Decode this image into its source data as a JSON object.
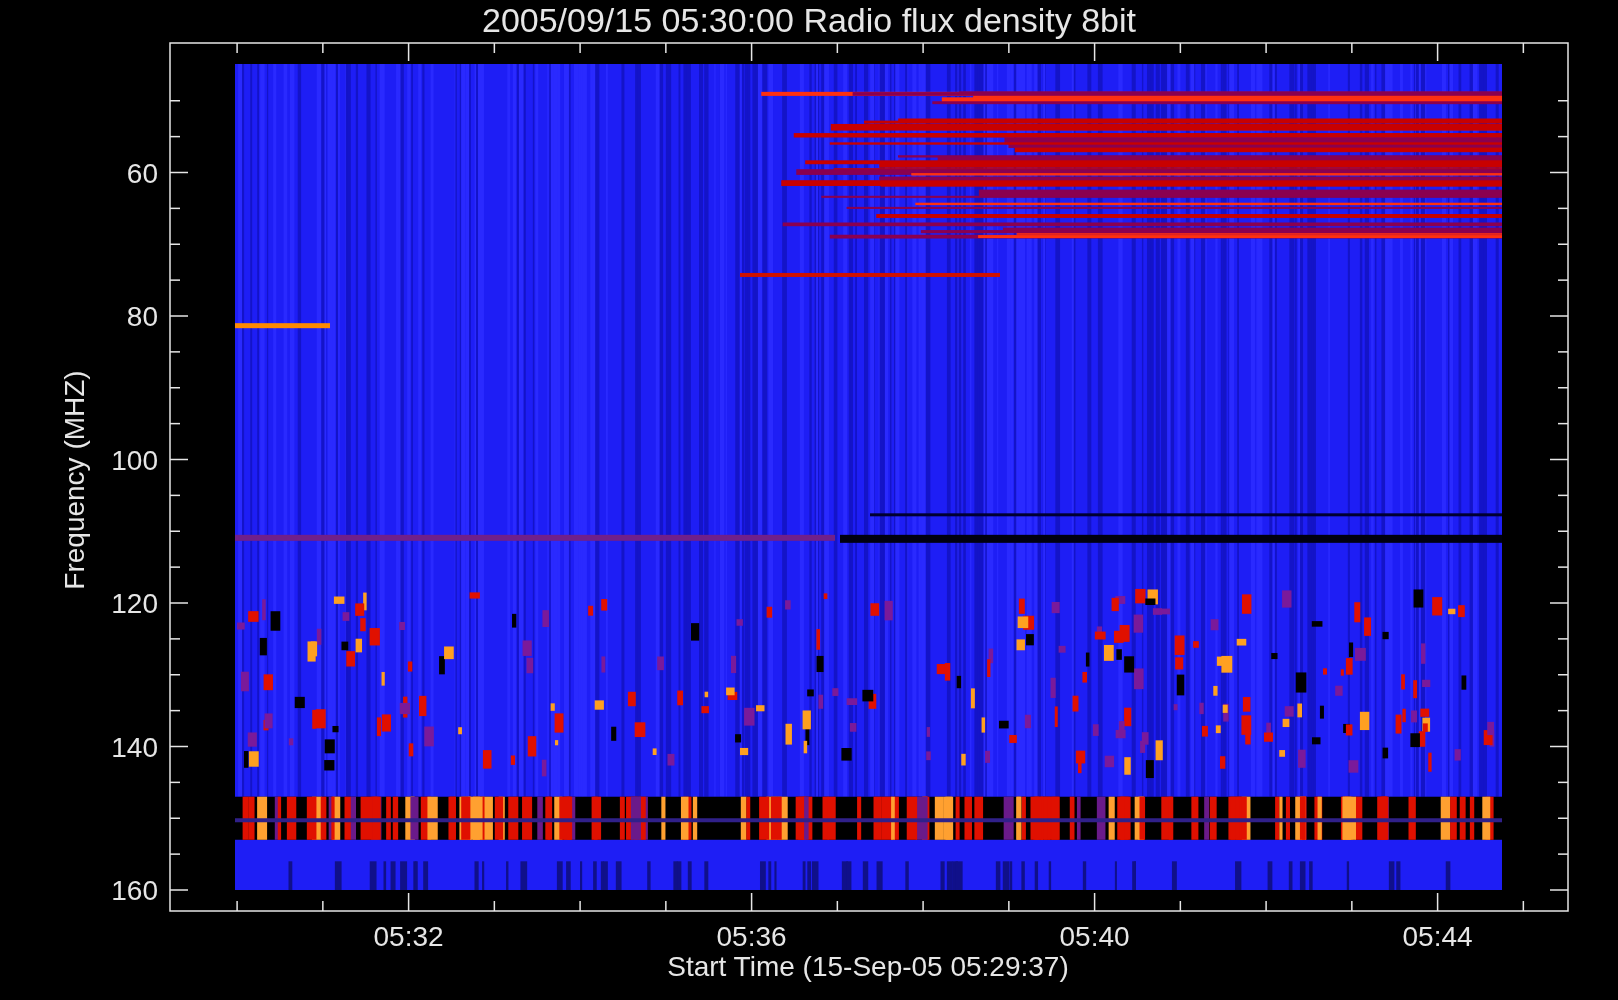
{
  "title": "2005/09/15 05:30:00 Radio flux density 8bit",
  "y_axis": {
    "label": "Frequency (MHZ)",
    "ticks": [
      "60",
      "80",
      "100",
      "120",
      "140",
      "160"
    ]
  },
  "x_axis": {
    "label": "Start Time (15-Sep-05 05:29:37)",
    "ticks": [
      "05:32",
      "05:36",
      "05:40",
      "05:44"
    ]
  }
}
